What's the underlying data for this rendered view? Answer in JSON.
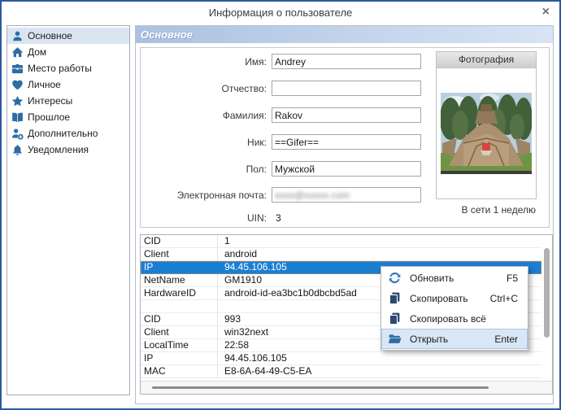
{
  "window": {
    "title": "Информация о пользователе",
    "close_icon": "×"
  },
  "colors": {
    "window_border": "#2a5a9e",
    "icon_blue": "#2e6da4",
    "selection_blue": "#1a7fd3",
    "menu_highlight": "#d8e6f6",
    "header_gradient": [
      "#abc1e1",
      "#d8e4f5"
    ]
  },
  "sidebar": {
    "items": [
      {
        "label": "Основное",
        "icon": "person-icon",
        "selected": true
      },
      {
        "label": "Дом",
        "icon": "home-icon",
        "selected": false
      },
      {
        "label": "Место работы",
        "icon": "briefcase-icon",
        "selected": false
      },
      {
        "label": "Личное",
        "icon": "heart-icon",
        "selected": false
      },
      {
        "label": "Интересы",
        "icon": "star-icon",
        "selected": false
      },
      {
        "label": "Прошлое",
        "icon": "book-icon",
        "selected": false
      },
      {
        "label": "Дополнительно",
        "icon": "person-add-icon",
        "selected": false
      },
      {
        "label": "Уведомления",
        "icon": "bell-icon",
        "selected": false
      }
    ]
  },
  "main": {
    "section_header": "Основное",
    "form": {
      "fields": [
        {
          "label": "Имя:",
          "value": "Andrey"
        },
        {
          "label": "Отчество:",
          "value": ""
        },
        {
          "label": "Фамилия:",
          "value": "Rakov"
        },
        {
          "label": "Ник:",
          "value": "==Gifer=="
        },
        {
          "label": "Пол:",
          "value": "Мужской"
        },
        {
          "label": "Электронная почта:",
          "value": "xxxx@xxxxx.com",
          "obscured": true
        }
      ],
      "uin_label": "UIN:",
      "uin_value": "3"
    },
    "photo": {
      "header": "Фотография",
      "alt": "monument-photo"
    },
    "online_status": "В сети 1 неделю",
    "details_table": {
      "rows": [
        {
          "key": "CID",
          "value": "1",
          "selected": false
        },
        {
          "key": "Client",
          "value": "android",
          "selected": false
        },
        {
          "key": "IP",
          "value": "94.45.106.105",
          "selected": true
        },
        {
          "key": "NetName",
          "value": "GM1910",
          "selected": false
        },
        {
          "key": "HardwareID",
          "value": "android-id-ea3bc1b0dbcbd5ad",
          "selected": false
        },
        {
          "key": "",
          "value": "",
          "selected": false
        },
        {
          "key": "CID",
          "value": "993",
          "selected": false
        },
        {
          "key": "Client",
          "value": "win32next",
          "selected": false
        },
        {
          "key": "LocalTime",
          "value": "22:58",
          "selected": false
        },
        {
          "key": "IP",
          "value": "94.45.106.105",
          "selected": false
        },
        {
          "key": "MAC",
          "value": "E8-6A-64-49-C5-EA",
          "selected": false
        }
      ]
    }
  },
  "context_menu": {
    "items": [
      {
        "label": "Обновить",
        "shortcut": "F5",
        "icon": "refresh-icon",
        "highlighted": false
      },
      {
        "label": "Скопировать",
        "shortcut": "Ctrl+C",
        "icon": "copy-icon",
        "highlighted": false
      },
      {
        "label": "Скопировать всё",
        "shortcut": "",
        "icon": "copy-icon",
        "highlighted": false
      },
      {
        "label": "Открыть",
        "shortcut": "Enter",
        "icon": "folder-open-icon",
        "highlighted": true
      }
    ]
  }
}
